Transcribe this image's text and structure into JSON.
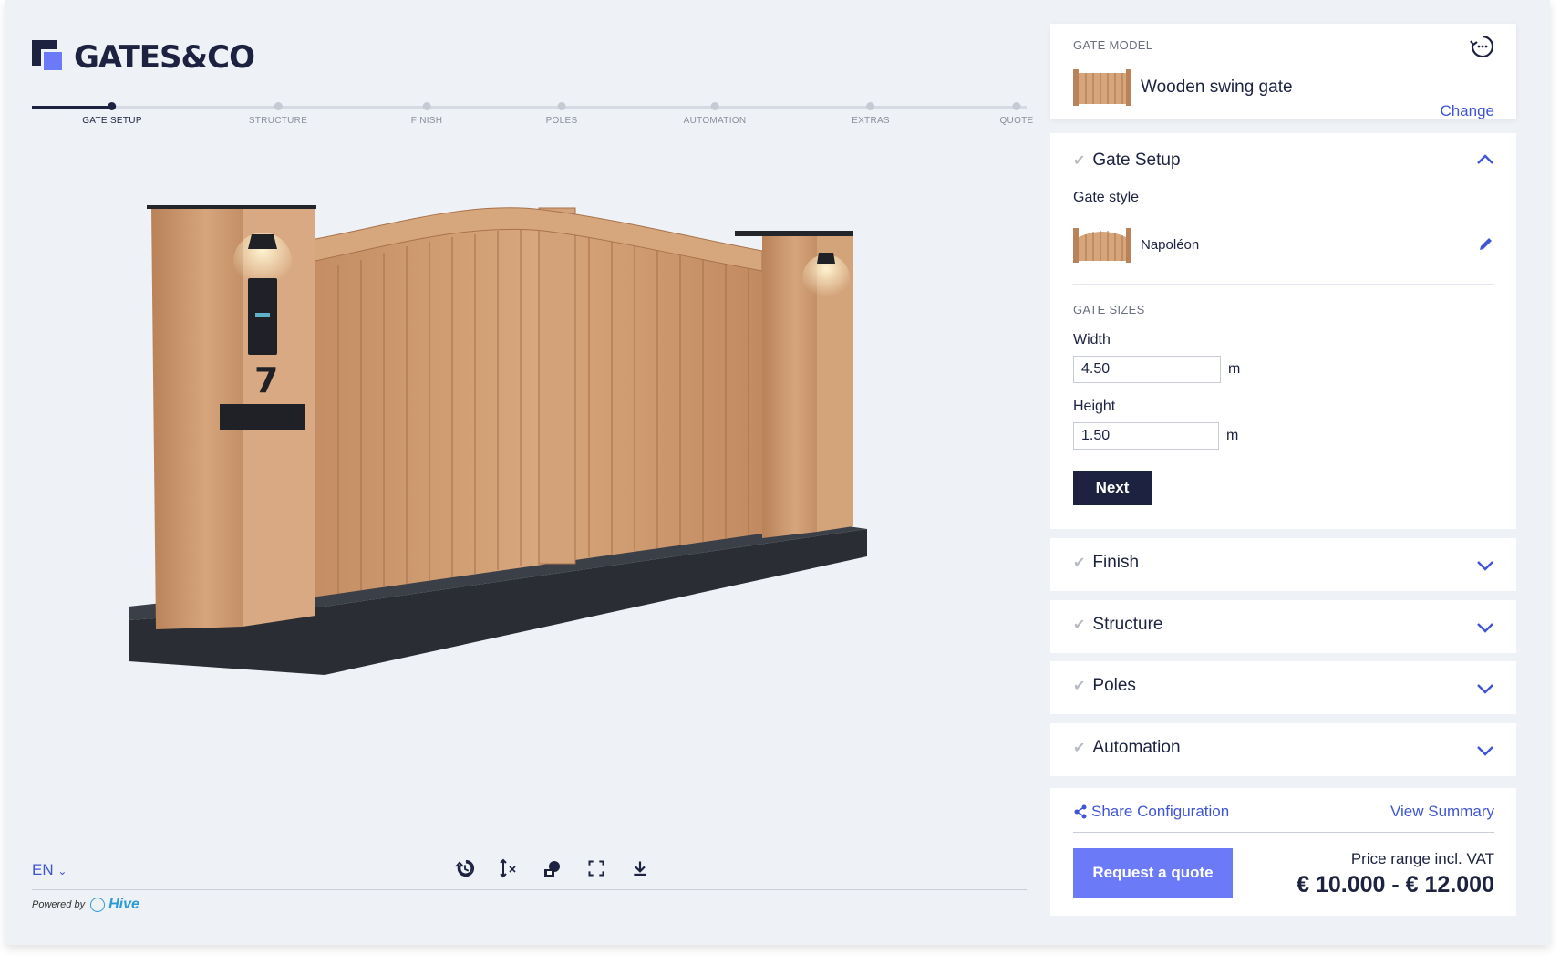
{
  "brand": {
    "name": "GATES&CO"
  },
  "progress": {
    "steps": [
      {
        "label": "GATE SETUP"
      },
      {
        "label": "STRUCTURE"
      },
      {
        "label": "FINISH"
      },
      {
        "label": "POLES"
      },
      {
        "label": "AUTOMATION"
      },
      {
        "label": "EXTRAS"
      },
      {
        "label": "QUOTE"
      }
    ],
    "active_step": "GATE SETUP"
  },
  "viewer": {
    "house_number": "7",
    "language": "EN",
    "tools": [
      {
        "icon": "history-icon"
      },
      {
        "icon": "dimensions-icon"
      },
      {
        "icon": "ar-view-icon"
      },
      {
        "icon": "fullscreen-icon"
      },
      {
        "icon": "download-icon"
      }
    ],
    "powered_by": "Powered by",
    "powered_brand": "Hive"
  },
  "model": {
    "section_label": "GATE MODEL",
    "name": "Wooden swing gate",
    "change_label": "Change"
  },
  "gate_setup": {
    "title": "Gate Setup",
    "style_label": "Gate style",
    "style_name": "Napoléon",
    "sizes_label": "GATE SIZES",
    "width_label": "Width",
    "width_value": "4.50",
    "height_label": "Height",
    "height_value": "1.50",
    "unit": "m",
    "next_label": "Next"
  },
  "accordions": [
    {
      "title": "Finish"
    },
    {
      "title": "Structure"
    },
    {
      "title": "Poles"
    },
    {
      "title": "Automation"
    }
  ],
  "footer": {
    "share_label": "Share Configuration",
    "summary_label": "View Summary",
    "quote_label": "Request a quote",
    "price_label": "Price range incl. VAT",
    "price_value": "€ 10.000 - € 12.000"
  },
  "colors": {
    "navy": "#1c2240",
    "accent": "#6b7bf7",
    "link": "#3f55d6",
    "wood": "#c9956a"
  }
}
